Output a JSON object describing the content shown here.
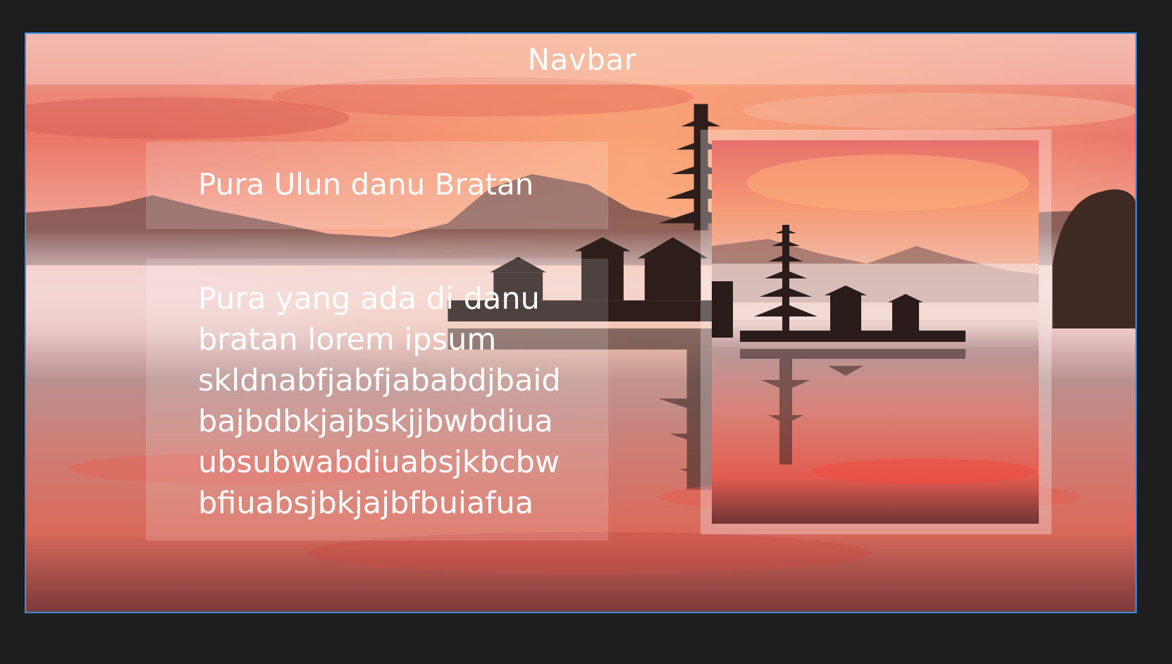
{
  "navbar": {
    "label": "Navbar"
  },
  "hero": {
    "title": "Pura Ulun danu Bratan",
    "description_lines": [
      "Pura yang ada di danu",
      "bratan lorem ipsum",
      "skldnabfjabfjababdjbaid",
      "bajbdbkjajbskjjbwbdiua",
      "ubsubwabdiuabsjkbcbw",
      "bfiuabsjbkjajbfbuiafua"
    ]
  },
  "colors": {
    "page_background": "#1e1e1e",
    "frame_border": "#3b8ff0",
    "sky_top": "#e8877a",
    "sky_glow": "#f48c6c",
    "water": "#c9867e"
  },
  "images": {
    "background": "lake-temple-sunset-background",
    "photo": "pura-ulun-danu-bratan-photo"
  }
}
